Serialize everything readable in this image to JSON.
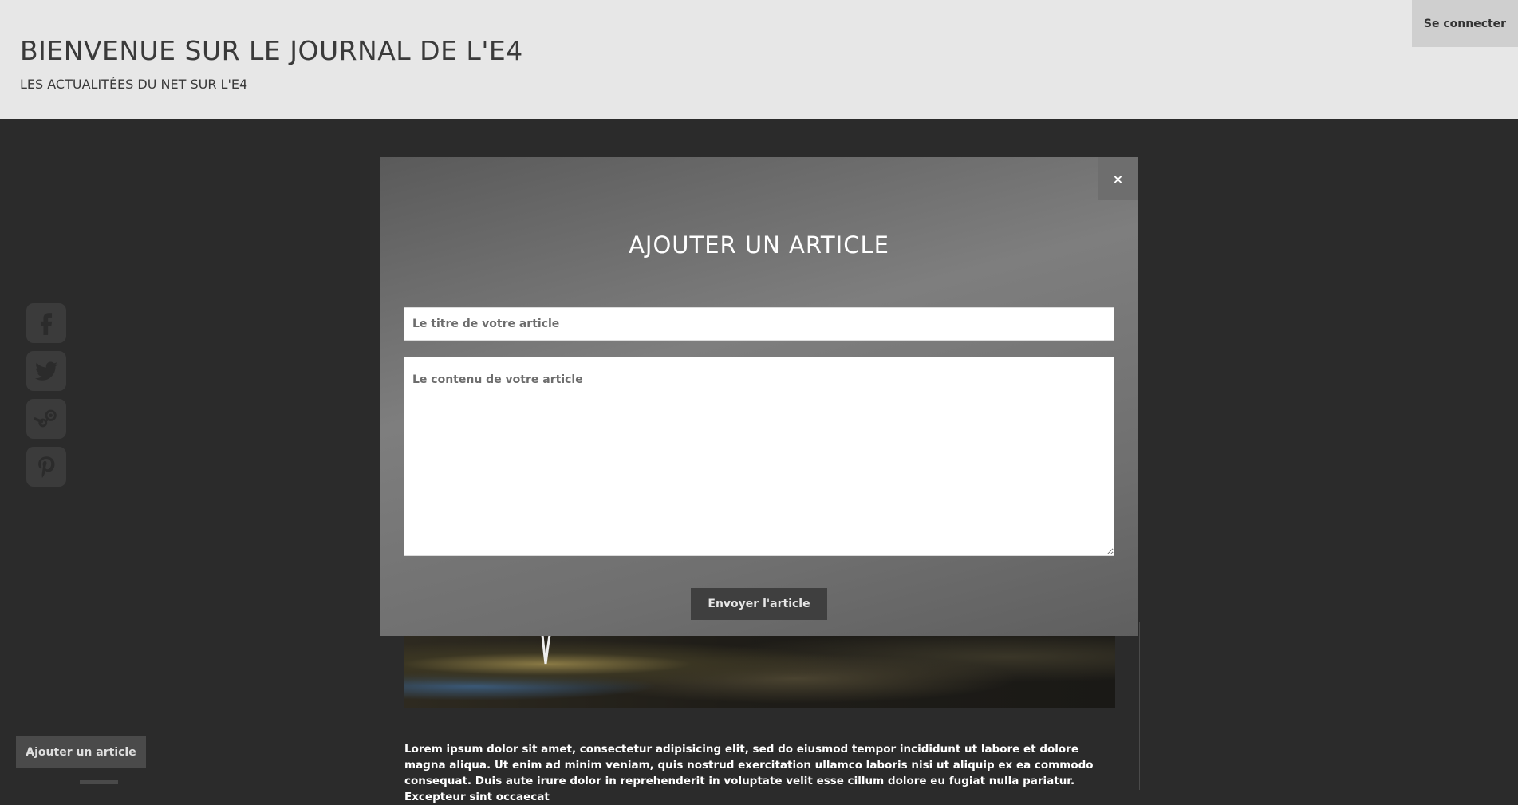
{
  "header": {
    "title": "BIENVENUE SUR LE JOURNAL DE L'E4",
    "subtitle": "LES ACTUALITÉES DU NET SUR L'E4",
    "login_label": "Se connecter"
  },
  "social": {
    "items": [
      {
        "name": "facebook",
        "icon": "facebook-icon"
      },
      {
        "name": "twitter",
        "icon": "twitter-icon"
      },
      {
        "name": "steam",
        "icon": "steam-icon"
      },
      {
        "name": "pinterest",
        "icon": "pinterest-icon"
      }
    ]
  },
  "modal": {
    "close_label": "×",
    "title": "AJOUTER UN ARTICLE",
    "title_placeholder": "Le titre de votre article",
    "content_placeholder": "Le contenu de votre article",
    "submit_label": "Envoyer l'article"
  },
  "article": {
    "body": "Lorem ipsum dolor sit amet, consectetur adipisicing elit, sed do eiusmod tempor incididunt ut labore et dolore magna aliqua. Ut enim ad minim veniam, quis nostrud exercitation ullamco laboris nisi ut aliquip ex ea commodo consequat. Duis aute irure dolor in reprehenderit in voluptate velit esse cillum dolore eu fugiat nulla pariatur. Excepteur sint occaecat"
  },
  "footer": {
    "add_article_label": "Ajouter un article"
  },
  "colors": {
    "header_bg": "#e7e7e7",
    "page_bg": "#2b2b2b",
    "modal_bg": "#7e7e7e",
    "button_dark": "#3f3f3f"
  }
}
